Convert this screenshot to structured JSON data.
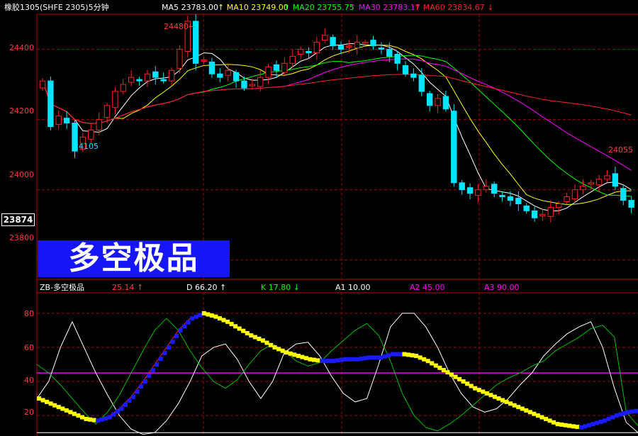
{
  "header": {
    "title": "橡胶1305(SHFE 2305)5分钟",
    "mas": [
      {
        "label": "MA5 23783.00",
        "color": "#ffffff"
      },
      {
        "label": "↑ MA10 23749.00",
        "color": "#ffff00"
      },
      {
        "label": "↑ MA20 23755.75",
        "color": "#00ff00"
      },
      {
        "label": "↑ MA30 23783.17",
        "color": "#ff00ff"
      },
      {
        "label": "↑ MA60  23834.67 ↓",
        "color": "#ff2020"
      }
    ]
  },
  "price_axis": {
    "ticks": [
      "24400",
      "24200",
      "24000",
      "23800"
    ]
  },
  "current_price": "23874",
  "annotations": {
    "high": "24480←",
    "low": "24105",
    "right_high": "24055"
  },
  "banner": {
    "text": "多空极品"
  },
  "indicator": {
    "name": "ZB-多空极品",
    "value": "25.14 ↑",
    "d": "D  66.20 ↑",
    "k": "K  17.80 ↓",
    "a1": "A1  10.00",
    "a2": "A2  45.00",
    "a3": "A3  90.00"
  },
  "indicator_axis": {
    "ticks": [
      "80",
      "60",
      "40",
      "20"
    ]
  },
  "colors": {
    "up": "#ff2020",
    "down": "#00e5ff",
    "grid": "#a00000",
    "ma5": "#ffffff",
    "ma10": "#ffff00",
    "ma20": "#00ff00",
    "ma30": "#ff00ff",
    "ma60": "#ff2020"
  },
  "chart_data": {
    "type": "candlestick",
    "price_range": [
      23745,
      24500
    ],
    "indicator_range": [
      8,
      92
    ],
    "levels": {
      "a1": 10,
      "a2": 45,
      "a3": 90
    },
    "closes": [
      24310,
      24180,
      24210,
      24190,
      24110,
      24150,
      24170,
      24200,
      24240,
      24280,
      24300,
      24320,
      24310,
      24330,
      24320,
      24310,
      24340,
      24400,
      24480,
      24360,
      24370,
      24330,
      24320,
      24340,
      24310,
      24290,
      24300,
      24320,
      24350,
      24340,
      24360,
      24380,
      24400,
      24390,
      24420,
      24440,
      24410,
      24400,
      24410,
      24420,
      24420,
      24410,
      24400,
      24380,
      24360,
      24330,
      24320,
      24280,
      24240,
      24260,
      24230,
      24020,
      24000,
      23990,
      24000,
      24010,
      23990,
      23980,
      23970,
      23960,
      23940,
      23920,
      23930,
      23950,
      23960,
      23980,
      24000,
      24010,
      24020,
      24030,
      24040,
      24010,
      23970,
      23950
    ],
    "kline": [
      30,
      27,
      24,
      21,
      18,
      17,
      19,
      24,
      31,
      40,
      50,
      60,
      70,
      77,
      80,
      78,
      75,
      71,
      67,
      64,
      60,
      57,
      55,
      53,
      52,
      52,
      53,
      53,
      54,
      54,
      56,
      56,
      55,
      52,
      48,
      44,
      40,
      36,
      33,
      30,
      27,
      24,
      21,
      18,
      15,
      14,
      13,
      15,
      17,
      20,
      22,
      23
    ],
    "dline": [
      50,
      45,
      38,
      30,
      22,
      15,
      22,
      32,
      45,
      58,
      70,
      77,
      70,
      58,
      48,
      40,
      36,
      41,
      50,
      58,
      62,
      58,
      52,
      49,
      51,
      58,
      64,
      70,
      74,
      67,
      52,
      33,
      20,
      13,
      11,
      15,
      20,
      26,
      32,
      38,
      42,
      45,
      49,
      52,
      58,
      62,
      66,
      71,
      73,
      66,
      22,
      14
    ],
    "jline": [
      30,
      40,
      60,
      75,
      60,
      45,
      32,
      20,
      12,
      9,
      10,
      17,
      27,
      40,
      55,
      60,
      62,
      53,
      40,
      30,
      40,
      57,
      62,
      63,
      55,
      43,
      33,
      28,
      30,
      50,
      72,
      80,
      80,
      72,
      60,
      45,
      33,
      25,
      22,
      24,
      30,
      38,
      45,
      55,
      62,
      68,
      72,
      75,
      60,
      36,
      16,
      10
    ]
  }
}
